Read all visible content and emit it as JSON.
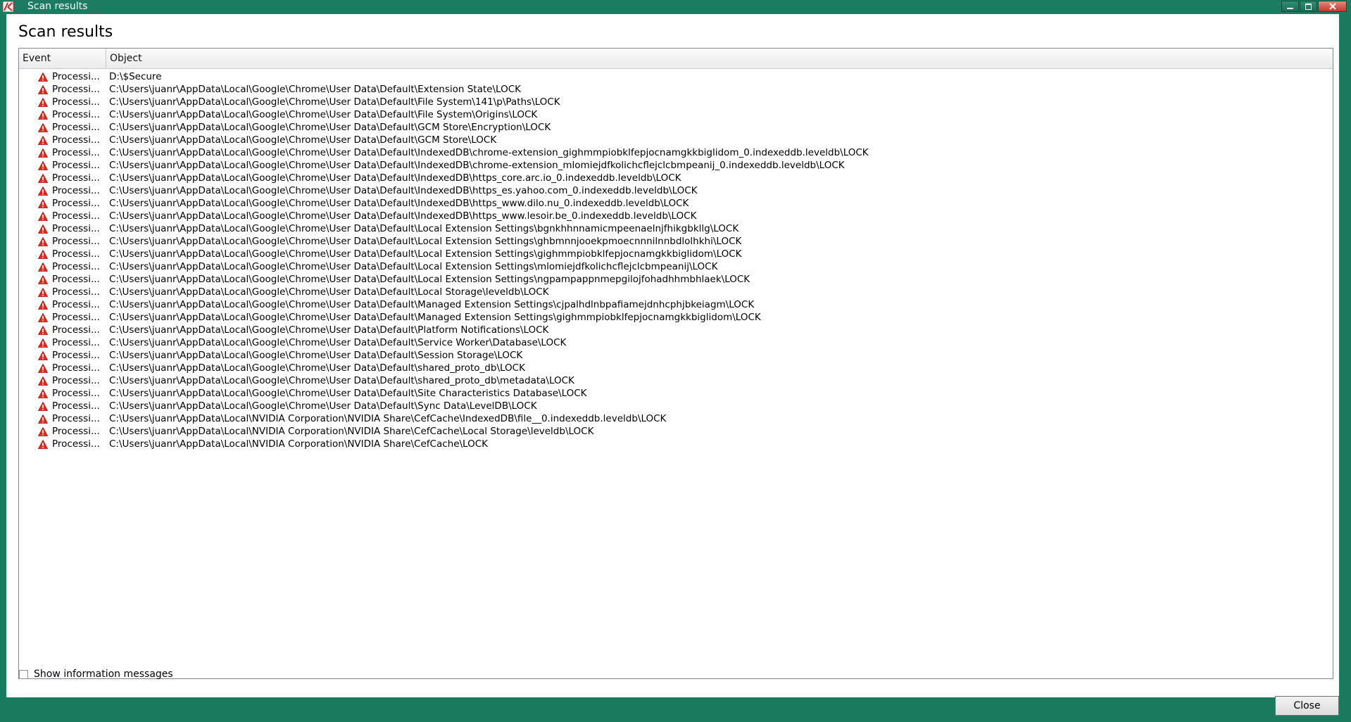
{
  "window": {
    "title": "Scan results"
  },
  "heading": "Scan results",
  "table": {
    "columns": [
      "Event",
      "Object"
    ],
    "event_label": "Processi...",
    "rows": [
      "D:\\$Secure",
      "C:\\Users\\juanr\\AppData\\Local\\Google\\Chrome\\User Data\\Default\\Extension State\\LOCK",
      "C:\\Users\\juanr\\AppData\\Local\\Google\\Chrome\\User Data\\Default\\File System\\141\\p\\Paths\\LOCK",
      "C:\\Users\\juanr\\AppData\\Local\\Google\\Chrome\\User Data\\Default\\File System\\Origins\\LOCK",
      "C:\\Users\\juanr\\AppData\\Local\\Google\\Chrome\\User Data\\Default\\GCM Store\\Encryption\\LOCK",
      "C:\\Users\\juanr\\AppData\\Local\\Google\\Chrome\\User Data\\Default\\GCM Store\\LOCK",
      "C:\\Users\\juanr\\AppData\\Local\\Google\\Chrome\\User Data\\Default\\IndexedDB\\chrome-extension_gighmmpiobklfepjocnamgkkbiglidom_0.indexeddb.leveldb\\LOCK",
      "C:\\Users\\juanr\\AppData\\Local\\Google\\Chrome\\User Data\\Default\\IndexedDB\\chrome-extension_mlomiejdfkolichcflejclcbmpeanij_0.indexeddb.leveldb\\LOCK",
      "C:\\Users\\juanr\\AppData\\Local\\Google\\Chrome\\User Data\\Default\\IndexedDB\\https_core.arc.io_0.indexeddb.leveldb\\LOCK",
      "C:\\Users\\juanr\\AppData\\Local\\Google\\Chrome\\User Data\\Default\\IndexedDB\\https_es.yahoo.com_0.indexeddb.leveldb\\LOCK",
      "C:\\Users\\juanr\\AppData\\Local\\Google\\Chrome\\User Data\\Default\\IndexedDB\\https_www.dilo.nu_0.indexeddb.leveldb\\LOCK",
      "C:\\Users\\juanr\\AppData\\Local\\Google\\Chrome\\User Data\\Default\\IndexedDB\\https_www.lesoir.be_0.indexeddb.leveldb\\LOCK",
      "C:\\Users\\juanr\\AppData\\Local\\Google\\Chrome\\User Data\\Default\\Local Extension Settings\\bgnkhhnnamicmpeenaelnjfhikgbkllg\\LOCK",
      "C:\\Users\\juanr\\AppData\\Local\\Google\\Chrome\\User Data\\Default\\Local Extension Settings\\ghbmnnjooekpmoecnnnilnnbdlolhkhi\\LOCK",
      "C:\\Users\\juanr\\AppData\\Local\\Google\\Chrome\\User Data\\Default\\Local Extension Settings\\gighmmpiobklfepjocnamgkkbiglidom\\LOCK",
      "C:\\Users\\juanr\\AppData\\Local\\Google\\Chrome\\User Data\\Default\\Local Extension Settings\\mlomiejdfkolichcflejclcbmpeanij\\LOCK",
      "C:\\Users\\juanr\\AppData\\Local\\Google\\Chrome\\User Data\\Default\\Local Extension Settings\\ngpampappnmepgilojfohadhhmbhlaek\\LOCK",
      "C:\\Users\\juanr\\AppData\\Local\\Google\\Chrome\\User Data\\Default\\Local Storage\\leveldb\\LOCK",
      "C:\\Users\\juanr\\AppData\\Local\\Google\\Chrome\\User Data\\Default\\Managed Extension Settings\\cjpalhdlnbpafiamejdnhcphjbkeiagm\\LOCK",
      "C:\\Users\\juanr\\AppData\\Local\\Google\\Chrome\\User Data\\Default\\Managed Extension Settings\\gighmmpiobklfepjocnamgkkbiglidom\\LOCK",
      "C:\\Users\\juanr\\AppData\\Local\\Google\\Chrome\\User Data\\Default\\Platform Notifications\\LOCK",
      "C:\\Users\\juanr\\AppData\\Local\\Google\\Chrome\\User Data\\Default\\Service Worker\\Database\\LOCK",
      "C:\\Users\\juanr\\AppData\\Local\\Google\\Chrome\\User Data\\Default\\Session Storage\\LOCK",
      "C:\\Users\\juanr\\AppData\\Local\\Google\\Chrome\\User Data\\Default\\shared_proto_db\\LOCK",
      "C:\\Users\\juanr\\AppData\\Local\\Google\\Chrome\\User Data\\Default\\shared_proto_db\\metadata\\LOCK",
      "C:\\Users\\juanr\\AppData\\Local\\Google\\Chrome\\User Data\\Default\\Site Characteristics Database\\LOCK",
      "C:\\Users\\juanr\\AppData\\Local\\Google\\Chrome\\User Data\\Default\\Sync Data\\LevelDB\\LOCK",
      "C:\\Users\\juanr\\AppData\\Local\\NVIDIA Corporation\\NVIDIA Share\\CefCache\\IndexedDB\\file__0.indexeddb.leveldb\\LOCK",
      "C:\\Users\\juanr\\AppData\\Local\\NVIDIA Corporation\\NVIDIA Share\\CefCache\\Local Storage\\leveldb\\LOCK",
      "C:\\Users\\juanr\\AppData\\Local\\NVIDIA Corporation\\NVIDIA Share\\CefCache\\LOCK"
    ]
  },
  "footer": {
    "show_info_label": "Show information messages",
    "show_info_checked": false,
    "close_label": "Close"
  },
  "icons": {
    "app": "kaspersky-app-icon",
    "row": "warning-triangle-icon"
  },
  "colors": {
    "frame": "#1b7c61",
    "warning": "#e8281b"
  }
}
